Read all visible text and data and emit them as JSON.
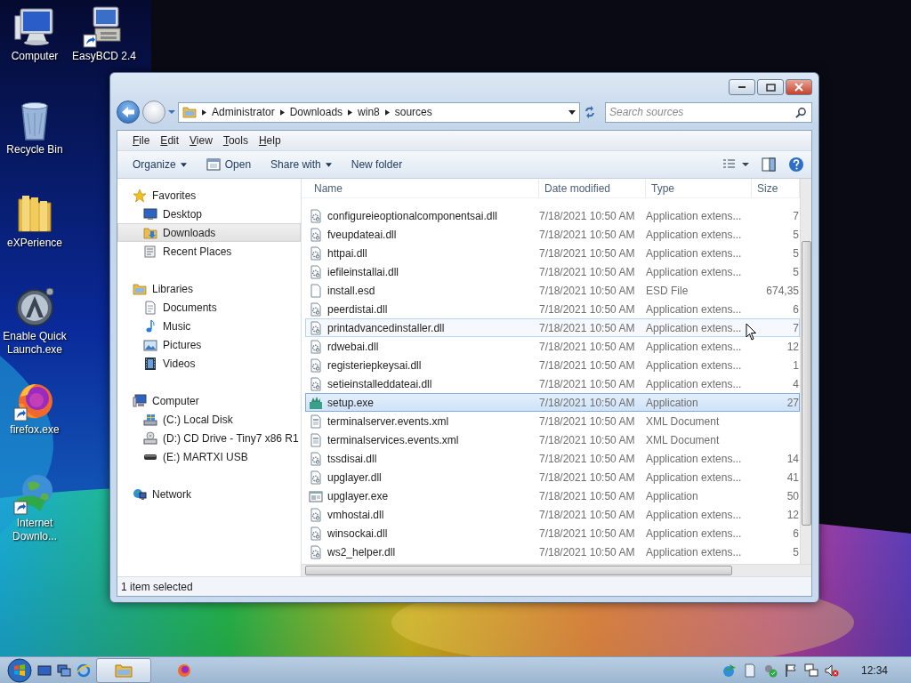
{
  "desktop_icons": [
    {
      "label": "Computer",
      "kind": "computer",
      "shortcut": false
    },
    {
      "label": "EasyBCD 2.4",
      "kind": "easybcd",
      "shortcut": true
    },
    {
      "label": "Recycle Bin",
      "kind": "recycle",
      "shortcut": false
    },
    {
      "label": "eXPerience",
      "kind": "folder",
      "shortcut": false
    },
    {
      "label": "Enable Quick Launch.exe",
      "kind": "launcher",
      "shortcut": false
    },
    {
      "label": "firefox.exe",
      "kind": "firefox",
      "shortcut": true
    },
    {
      "label": "Internet Downlo...",
      "kind": "globe",
      "shortcut": true
    }
  ],
  "window": {
    "breadcrumb": [
      "Administrator",
      "Downloads",
      "win8",
      "sources"
    ],
    "search": {
      "placeholder": "Search sources"
    },
    "menu": [
      "File",
      "Edit",
      "View",
      "Tools",
      "Help"
    ],
    "toolbar": [
      {
        "label": "Organize",
        "kind": "dropdown"
      },
      {
        "label": "Open",
        "kind": "icon"
      },
      {
        "label": "Share with",
        "kind": "dropdown"
      },
      {
        "label": "New folder",
        "kind": "plain"
      }
    ],
    "nav_pane": [
      {
        "label": "Favorites",
        "selected": false,
        "children": [
          {
            "label": "Desktop",
            "selected": false
          },
          {
            "label": "Downloads",
            "selected": true
          },
          {
            "label": "Recent Places",
            "selected": false
          }
        ]
      },
      {
        "label": "Libraries",
        "selected": false,
        "children": [
          {
            "label": "Documents",
            "selected": false
          },
          {
            "label": "Music",
            "selected": false
          },
          {
            "label": "Pictures",
            "selected": false
          },
          {
            "label": "Videos",
            "selected": false
          }
        ]
      },
      {
        "label": "Computer",
        "selected": false,
        "children": [
          {
            "label": "(C:) Local Disk",
            "selected": false
          },
          {
            "label": "(D:) CD Drive - Tiny7 x86 R1",
            "selected": false
          },
          {
            "label": "(E:) MARTXI USB",
            "selected": false
          }
        ]
      },
      {
        "label": "Network",
        "selected": false
      }
    ],
    "columns": [
      "Name",
      "Date modified",
      "Type",
      "Size"
    ],
    "rows": [
      {
        "name": "configureieoptionalcomponentsai.dll",
        "date": "7/18/2021 10:50 AM",
        "type": "Application extens...",
        "size": "7",
        "kind": "dll",
        "selected": false,
        "hovered": false
      },
      {
        "name": "fveupdateai.dll",
        "date": "7/18/2021 10:50 AM",
        "type": "Application extens...",
        "size": "5",
        "kind": "dll",
        "selected": false,
        "hovered": false
      },
      {
        "name": "httpai.dll",
        "date": "7/18/2021 10:50 AM",
        "type": "Application extens...",
        "size": "5",
        "kind": "dll",
        "selected": false,
        "hovered": false
      },
      {
        "name": "iefileinstallai.dll",
        "date": "7/18/2021 10:50 AM",
        "type": "Application extens...",
        "size": "5",
        "kind": "dll",
        "selected": false,
        "hovered": false
      },
      {
        "name": "install.esd",
        "date": "7/18/2021 10:50 AM",
        "type": "ESD File",
        "size": "674,35",
        "kind": "blank",
        "selected": false,
        "hovered": false
      },
      {
        "name": "peerdistai.dll",
        "date": "7/18/2021 10:50 AM",
        "type": "Application extens...",
        "size": "6",
        "kind": "dll",
        "selected": false,
        "hovered": false
      },
      {
        "name": "printadvancedinstaller.dll",
        "date": "7/18/2021 10:50 AM",
        "type": "Application extens...",
        "size": "7",
        "kind": "dll",
        "selected": false,
        "hovered": true
      },
      {
        "name": "rdwebai.dll",
        "date": "7/18/2021 10:50 AM",
        "type": "Application extens...",
        "size": "12",
        "kind": "dll",
        "selected": false,
        "hovered": false
      },
      {
        "name": "registeriepkeysai.dll",
        "date": "7/18/2021 10:50 AM",
        "type": "Application extens...",
        "size": "1",
        "kind": "dll",
        "selected": false,
        "hovered": false
      },
      {
        "name": "setieinstalleddateai.dll",
        "date": "7/18/2021 10:50 AM",
        "type": "Application extens...",
        "size": "4",
        "kind": "dll",
        "selected": false,
        "hovered": false
      },
      {
        "name": "setup.exe",
        "date": "7/18/2021 10:50 AM",
        "type": "Application",
        "size": "27",
        "kind": "setup",
        "selected": true,
        "hovered": false
      },
      {
        "name": "terminalserver.events.xml",
        "date": "7/18/2021 10:50 AM",
        "type": "XML Document",
        "kind": "xml",
        "selected": false,
        "hovered": false
      },
      {
        "name": "terminalservices.events.xml",
        "date": "7/18/2021 10:50 AM",
        "type": "XML Document",
        "kind": "xml",
        "selected": false,
        "hovered": false
      },
      {
        "name": "tssdisai.dll",
        "date": "7/18/2021 10:50 AM",
        "type": "Application extens...",
        "size": "14",
        "kind": "dll",
        "selected": false,
        "hovered": false
      },
      {
        "name": "upglayer.dll",
        "date": "7/18/2021 10:50 AM",
        "type": "Application extens...",
        "size": "41",
        "kind": "dll",
        "selected": false,
        "hovered": false
      },
      {
        "name": "upglayer.exe",
        "date": "7/18/2021 10:50 AM",
        "type": "Application",
        "size": "50",
        "kind": "exe",
        "selected": false,
        "hovered": false
      },
      {
        "name": "vmhostai.dll",
        "date": "7/18/2021 10:50 AM",
        "type": "Application extens...",
        "size": "12",
        "kind": "dll",
        "selected": false,
        "hovered": false
      },
      {
        "name": "winsockai.dll",
        "date": "7/18/2021 10:50 AM",
        "type": "Application extens...",
        "size": "6",
        "kind": "dll",
        "selected": false,
        "hovered": false
      },
      {
        "name": "ws2_helper.dll",
        "date": "7/18/2021 10:50 AM",
        "type": "Application extens...",
        "size": "5",
        "kind": "dll",
        "selected": false,
        "hovered": false
      }
    ],
    "status_bar": "1 item selected"
  },
  "taskbar": {
    "items": [
      {
        "kind": "explorer",
        "active": true
      },
      {
        "kind": "firefox",
        "active": false
      }
    ],
    "clock": "12:34"
  }
}
